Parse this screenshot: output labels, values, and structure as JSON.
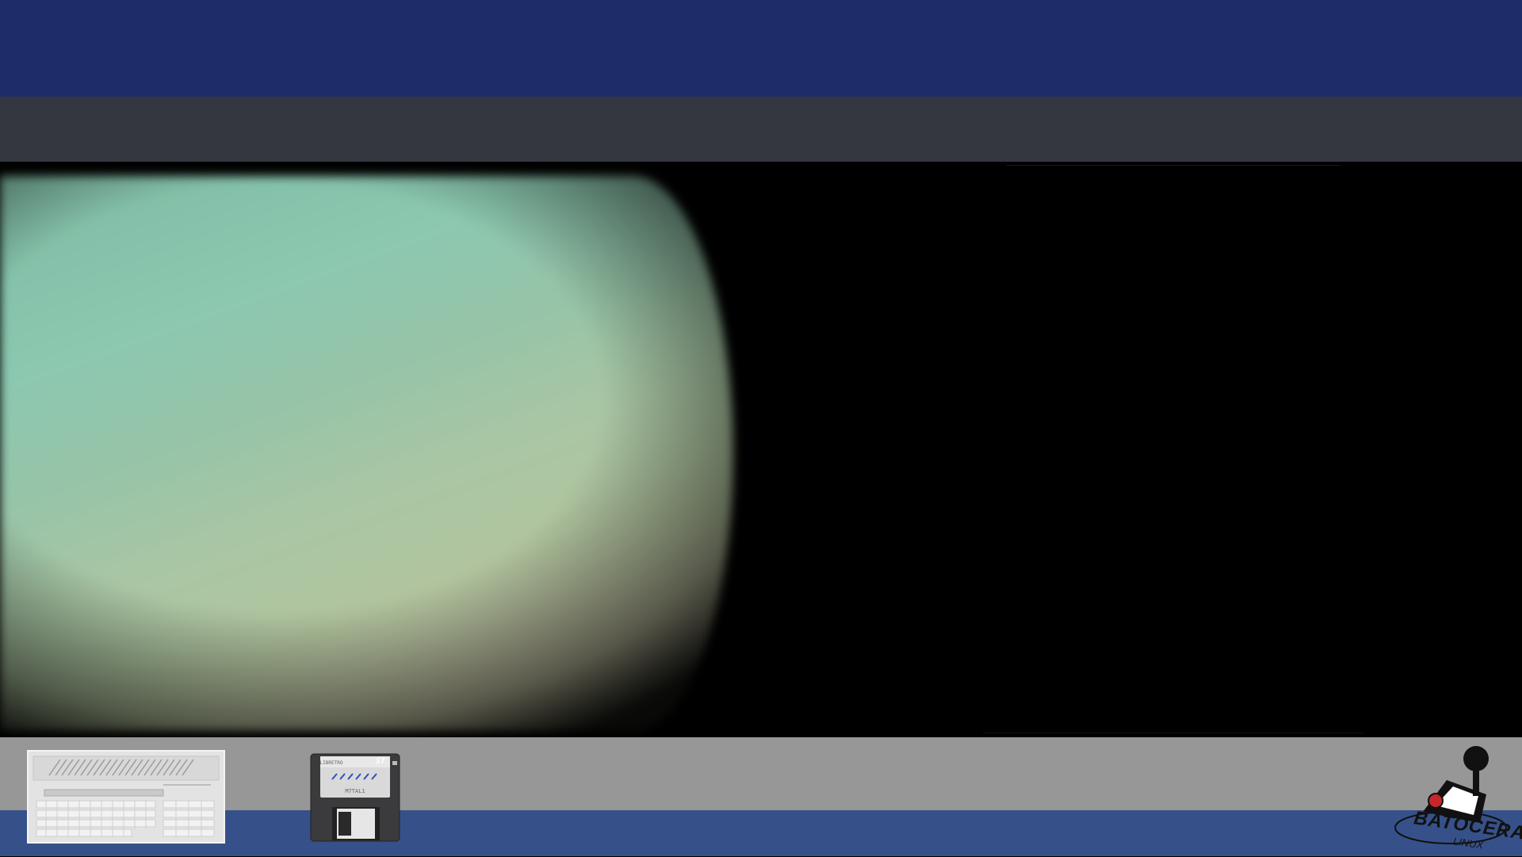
{
  "system": {
    "name": "Atari ST"
  },
  "floppy": {
    "brand": "LIBRETRO",
    "badge": "ST",
    "label_text": "M7TAL1"
  },
  "branding": {
    "logo_title": "BATOCERA",
    "logo_subtitle": "LINUX"
  },
  "colors": {
    "top_banner": "#1e2d6a",
    "header_bar": "#343740",
    "bottom_gray": "#979797",
    "bottom_blue": "#36518a",
    "logo_accent": "#c8262b"
  },
  "icons": {
    "computer": "atari-st-computer-icon",
    "floppy": "floppy-disk-icon",
    "logo": "joystick-icon"
  }
}
